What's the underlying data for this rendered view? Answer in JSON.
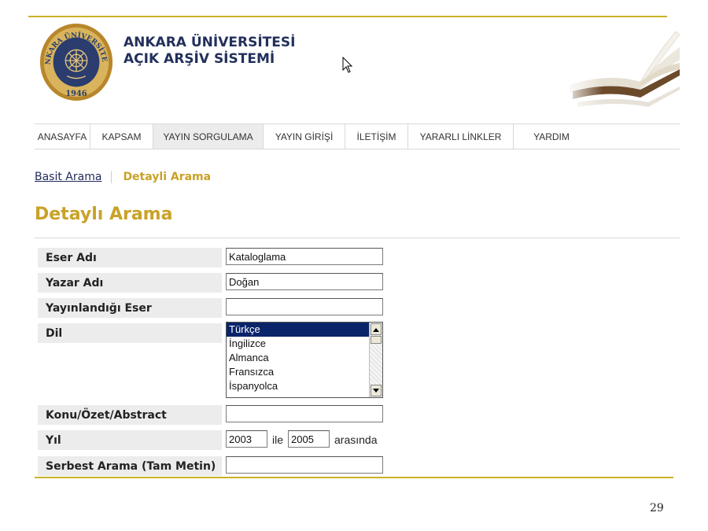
{
  "site": {
    "seal_text": "ANKARA ÜNİVERSİTESİ",
    "seal_year": "1946",
    "title_line1": "ANKARA ÜNİVERSİTESİ",
    "title_line2": "AÇIK ARŞİV SİSTEMİ"
  },
  "nav": {
    "items": [
      {
        "label": "ANASAYFA"
      },
      {
        "label": "KAPSAM"
      },
      {
        "label": "YAYIN SORGULAMA",
        "active": true
      },
      {
        "label": "YAYIN GİRİŞİ"
      },
      {
        "label": "İLETİŞİM"
      },
      {
        "label": "YARARLI LİNKLER"
      },
      {
        "label": "YARDIM"
      }
    ]
  },
  "subtabs": {
    "basic": "Basit Arama",
    "detailed": "Detayli Arama"
  },
  "page_title": "Detaylı Arama",
  "form": {
    "title_label": "Eser Adı",
    "title_value": "Kataloglama",
    "author_label": "Yazar Adı",
    "author_value": "Doğan",
    "published_in_label": "Yayınlandığı Eser",
    "published_in_value": "",
    "language_label": "Dil",
    "language_options": [
      "Türkçe",
      "İngilizce",
      "Almanca",
      "Fransızca",
      "İspanyolca"
    ],
    "language_selected": "Türkçe",
    "subject_label": "Konu/Özet/Abstract",
    "subject_value": "",
    "year_label": "Yıl",
    "year_from": "2003",
    "year_between_word": "ile",
    "year_to": "2005",
    "year_suffix": "arasında",
    "fulltext_label": "Serbest Arama (Tam Metin)",
    "fulltext_value": ""
  },
  "slide_number": "29",
  "colors": {
    "accent_gold": "#c9a227",
    "rule_gold": "#c9b227",
    "title_navy": "#23305c",
    "selection_blue": "#0a246a"
  }
}
